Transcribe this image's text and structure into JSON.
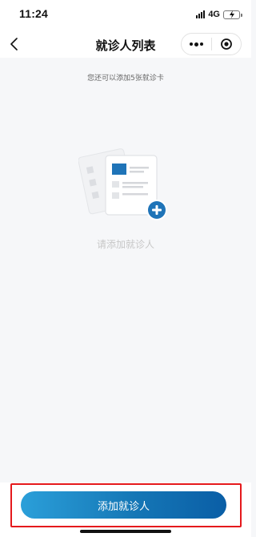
{
  "status_bar": {
    "time": "11:24",
    "network": "4G",
    "battery_color": "#f2c300"
  },
  "nav": {
    "title": "就诊人列表",
    "back_icon": "chevron-left-icon",
    "more_icon": "more-dots-icon",
    "close_icon": "target-close-icon"
  },
  "main": {
    "remaining_hint": "您还可以添加5张就诊卡",
    "empty_text": "请添加就诊人",
    "illustration_icon": "id-card-add-icon"
  },
  "footer": {
    "add_button_label": "添加就诊人"
  },
  "colors": {
    "accent": "#1577b6",
    "highlight": "#e5191c",
    "background": "#f6f7f9"
  }
}
